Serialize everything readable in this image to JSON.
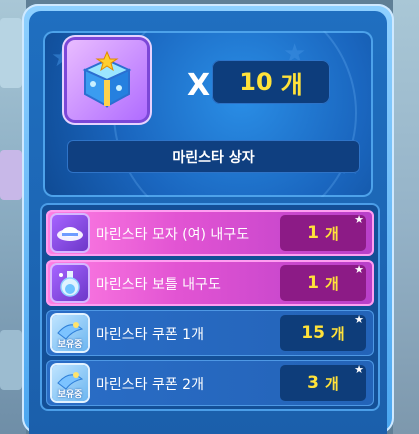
{
  "reward": {
    "multiplier_symbol": "X",
    "count": "10",
    "unit": "개",
    "item_name": "마린스타 상자"
  },
  "contents": [
    {
      "label": "마린스타 모자 (여) 내구도",
      "count": "1",
      "unit": "개",
      "style": "pink",
      "icon": "hat-blueprint-icon"
    },
    {
      "label": "마린스타 보틀 내구도",
      "count": "1",
      "unit": "개",
      "style": "pink",
      "icon": "bottle-blueprint-icon"
    },
    {
      "label": "마린스타 쿠폰 1개",
      "count": "15",
      "unit": "개",
      "style": "blue",
      "icon": "coupon-icon",
      "tag": "보유중"
    },
    {
      "label": "마린스타 쿠폰 2개",
      "count": "3",
      "unit": "개",
      "style": "blue",
      "icon": "coupon-icon",
      "tag": "보유중"
    }
  ]
}
